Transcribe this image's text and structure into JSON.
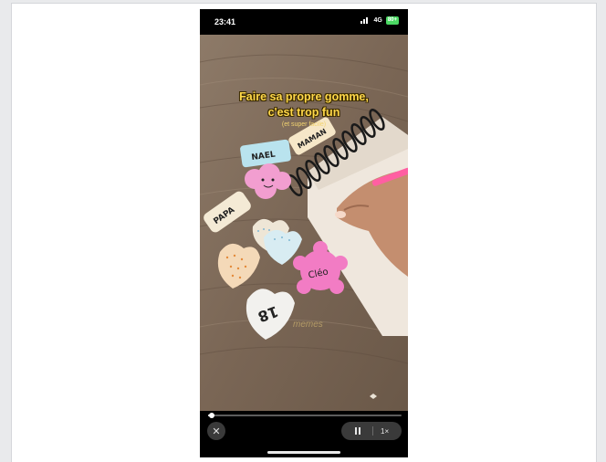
{
  "status_bar": {
    "time": "23:41",
    "network": "4G",
    "battery": "80+"
  },
  "video": {
    "caption_line1": "Faire sa propre gomme,",
    "caption_line2": "c'est trop fun",
    "caption_sub": "(et super facile)",
    "labels": {
      "nael": "NAEL",
      "maman": "MAMAN",
      "papa": "PAPA",
      "cleo": "Cléo",
      "age": "18"
    },
    "watermark": "memes"
  },
  "controls": {
    "close_icon": "close-icon",
    "pause_icon": "pause-icon",
    "speed": "1×",
    "progress": 0.02
  },
  "colors": {
    "accent_caption": "#ffd84a",
    "controls_bg": "#3a3a3a"
  }
}
